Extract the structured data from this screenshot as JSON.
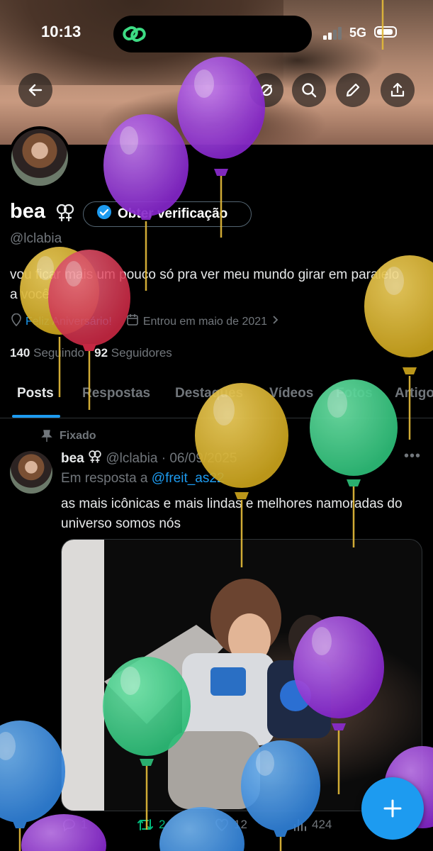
{
  "status_bar": {
    "time": "10:13",
    "network": "5G"
  },
  "profile": {
    "name": "bea",
    "handle": "@lclabia",
    "verify_button": "Obter verificação",
    "bio": "vou ficar mais um pouco só pra ver meu mundo girar em paralelo a você",
    "birthday": "Feliz Aniversário!",
    "joined": "Entrou em maio de 2021",
    "following_count": "140",
    "following_label": "Seguindo",
    "followers_count": "92",
    "followers_label": "Seguidores"
  },
  "tabs": [
    "Posts",
    "Respostas",
    "Destaques",
    "Vídeos",
    "Fotos",
    "Artigos"
  ],
  "tweet": {
    "pinned_label": "Fixado",
    "author_name": "bea",
    "handle_date": "@lclabia · 06/09/2025",
    "reply_prefix": "Em resposta a",
    "reply_mention": "@freit_as22",
    "text": "as mais icônicas e mais lindas e melhores namoradas do universo somos nós",
    "metrics": {
      "replies": "1",
      "retweets": "2",
      "likes": "12",
      "views": "424"
    }
  },
  "icons": [
    "back-arrow-icon",
    "search-icon",
    "edit-icon",
    "share-icon",
    "link-icon",
    "verified-check-icon",
    "location-icon",
    "calendar-icon",
    "pin-icon",
    "reply-icon",
    "retweet-icon",
    "like-icon",
    "views-icon",
    "plus-icon"
  ],
  "colors": {
    "accent": "#1d9bf0",
    "background": "#000000",
    "muted": "#71767b",
    "retweet": "#00ba7c"
  }
}
